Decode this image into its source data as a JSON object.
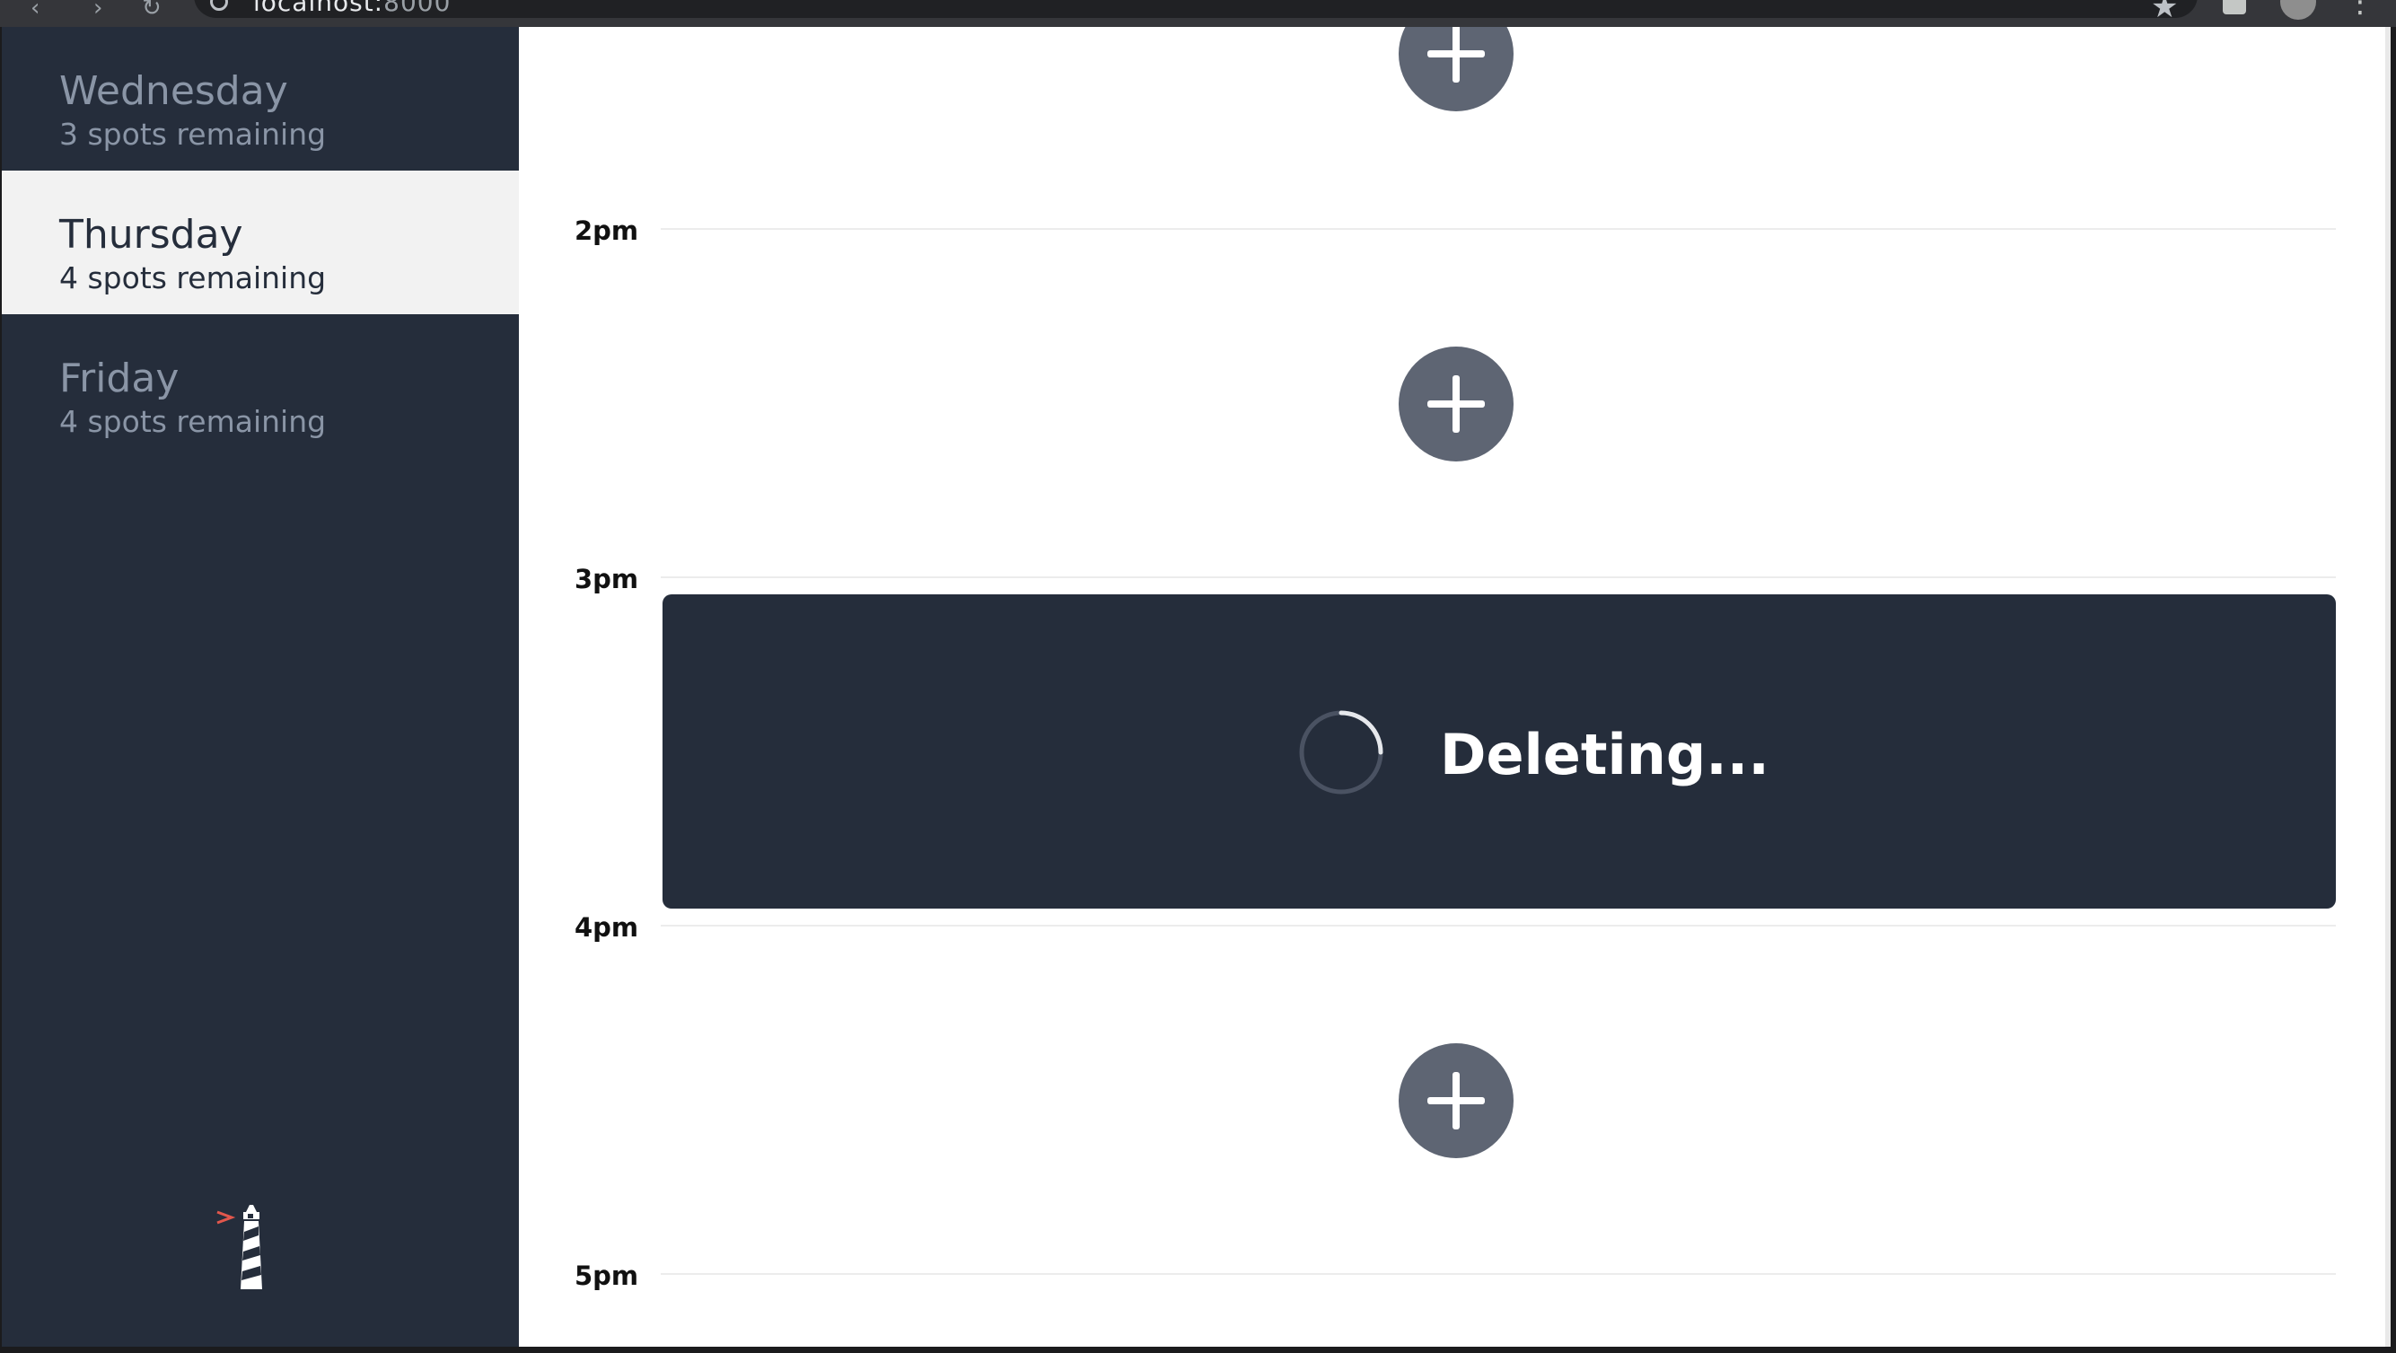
{
  "browser": {
    "url_host": "localhost:",
    "url_port": "8000"
  },
  "sidebar": {
    "days": [
      {
        "name": "Wednesday",
        "spots": "3 spots remaining",
        "selected": false
      },
      {
        "name": "Thursday",
        "spots": "4 spots remaining",
        "selected": true
      },
      {
        "name": "Friday",
        "spots": "4 spots remaining",
        "selected": false
      }
    ]
  },
  "schedule": {
    "time_labels": [
      "2pm",
      "3pm",
      "4pm",
      "5pm"
    ],
    "status_text": "Deleting..."
  },
  "colors": {
    "sidebar_bg": "#252d3b",
    "selected_bg": "#f2f2f2",
    "add_button": "#5e6573",
    "logo_accent": "#e2574c"
  },
  "icons": [
    "add-icon",
    "spinner-icon",
    "lighthouse-logo-icon",
    "star-icon",
    "menu-dots-icon"
  ]
}
